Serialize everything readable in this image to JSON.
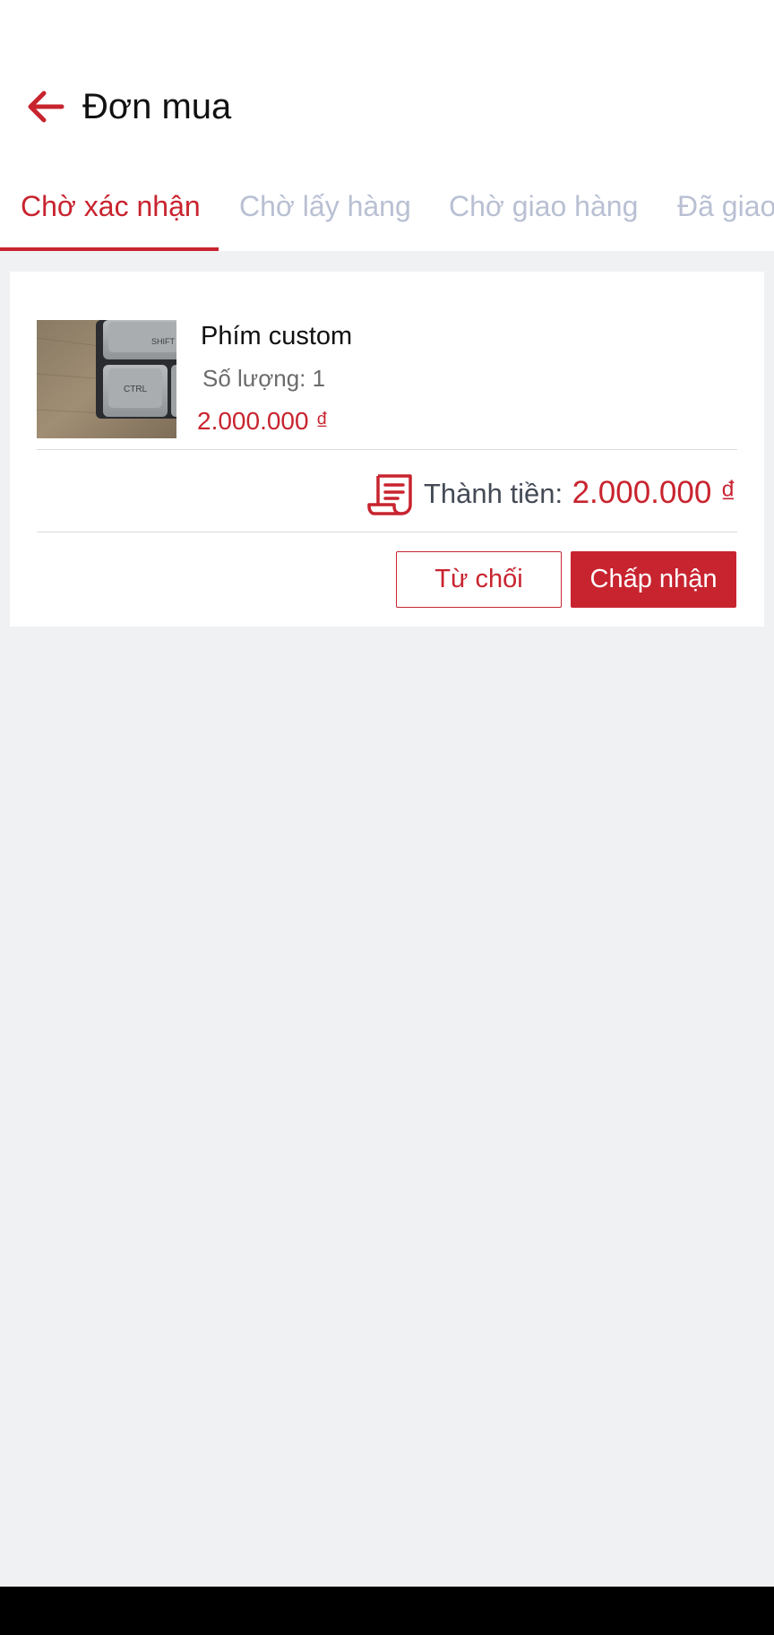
{
  "header": {
    "title": "Đơn mua",
    "back_icon": "arrow-left-icon",
    "accent_color": "#c8242f"
  },
  "tabs": [
    {
      "label": "Chờ xác nhận",
      "active": true
    },
    {
      "label": "Chờ lấy hàng",
      "active": false
    },
    {
      "label": "Chờ giao hàng",
      "active": false
    },
    {
      "label": "Đã giao",
      "active": false
    }
  ],
  "order": {
    "product": {
      "name": "Phím custom",
      "quantity": "Số lượng: 1",
      "price": "2.000.000 ₫",
      "image_icon": "keyboard-photo",
      "key_labels": [
        "SHIFT",
        "CTRL"
      ]
    },
    "total": {
      "icon": "receipt-icon",
      "label": "Thành tiền:",
      "value": "2.000.000 ₫"
    },
    "actions": {
      "reject_label": "Từ chối",
      "accept_label": "Chấp nhận"
    }
  }
}
